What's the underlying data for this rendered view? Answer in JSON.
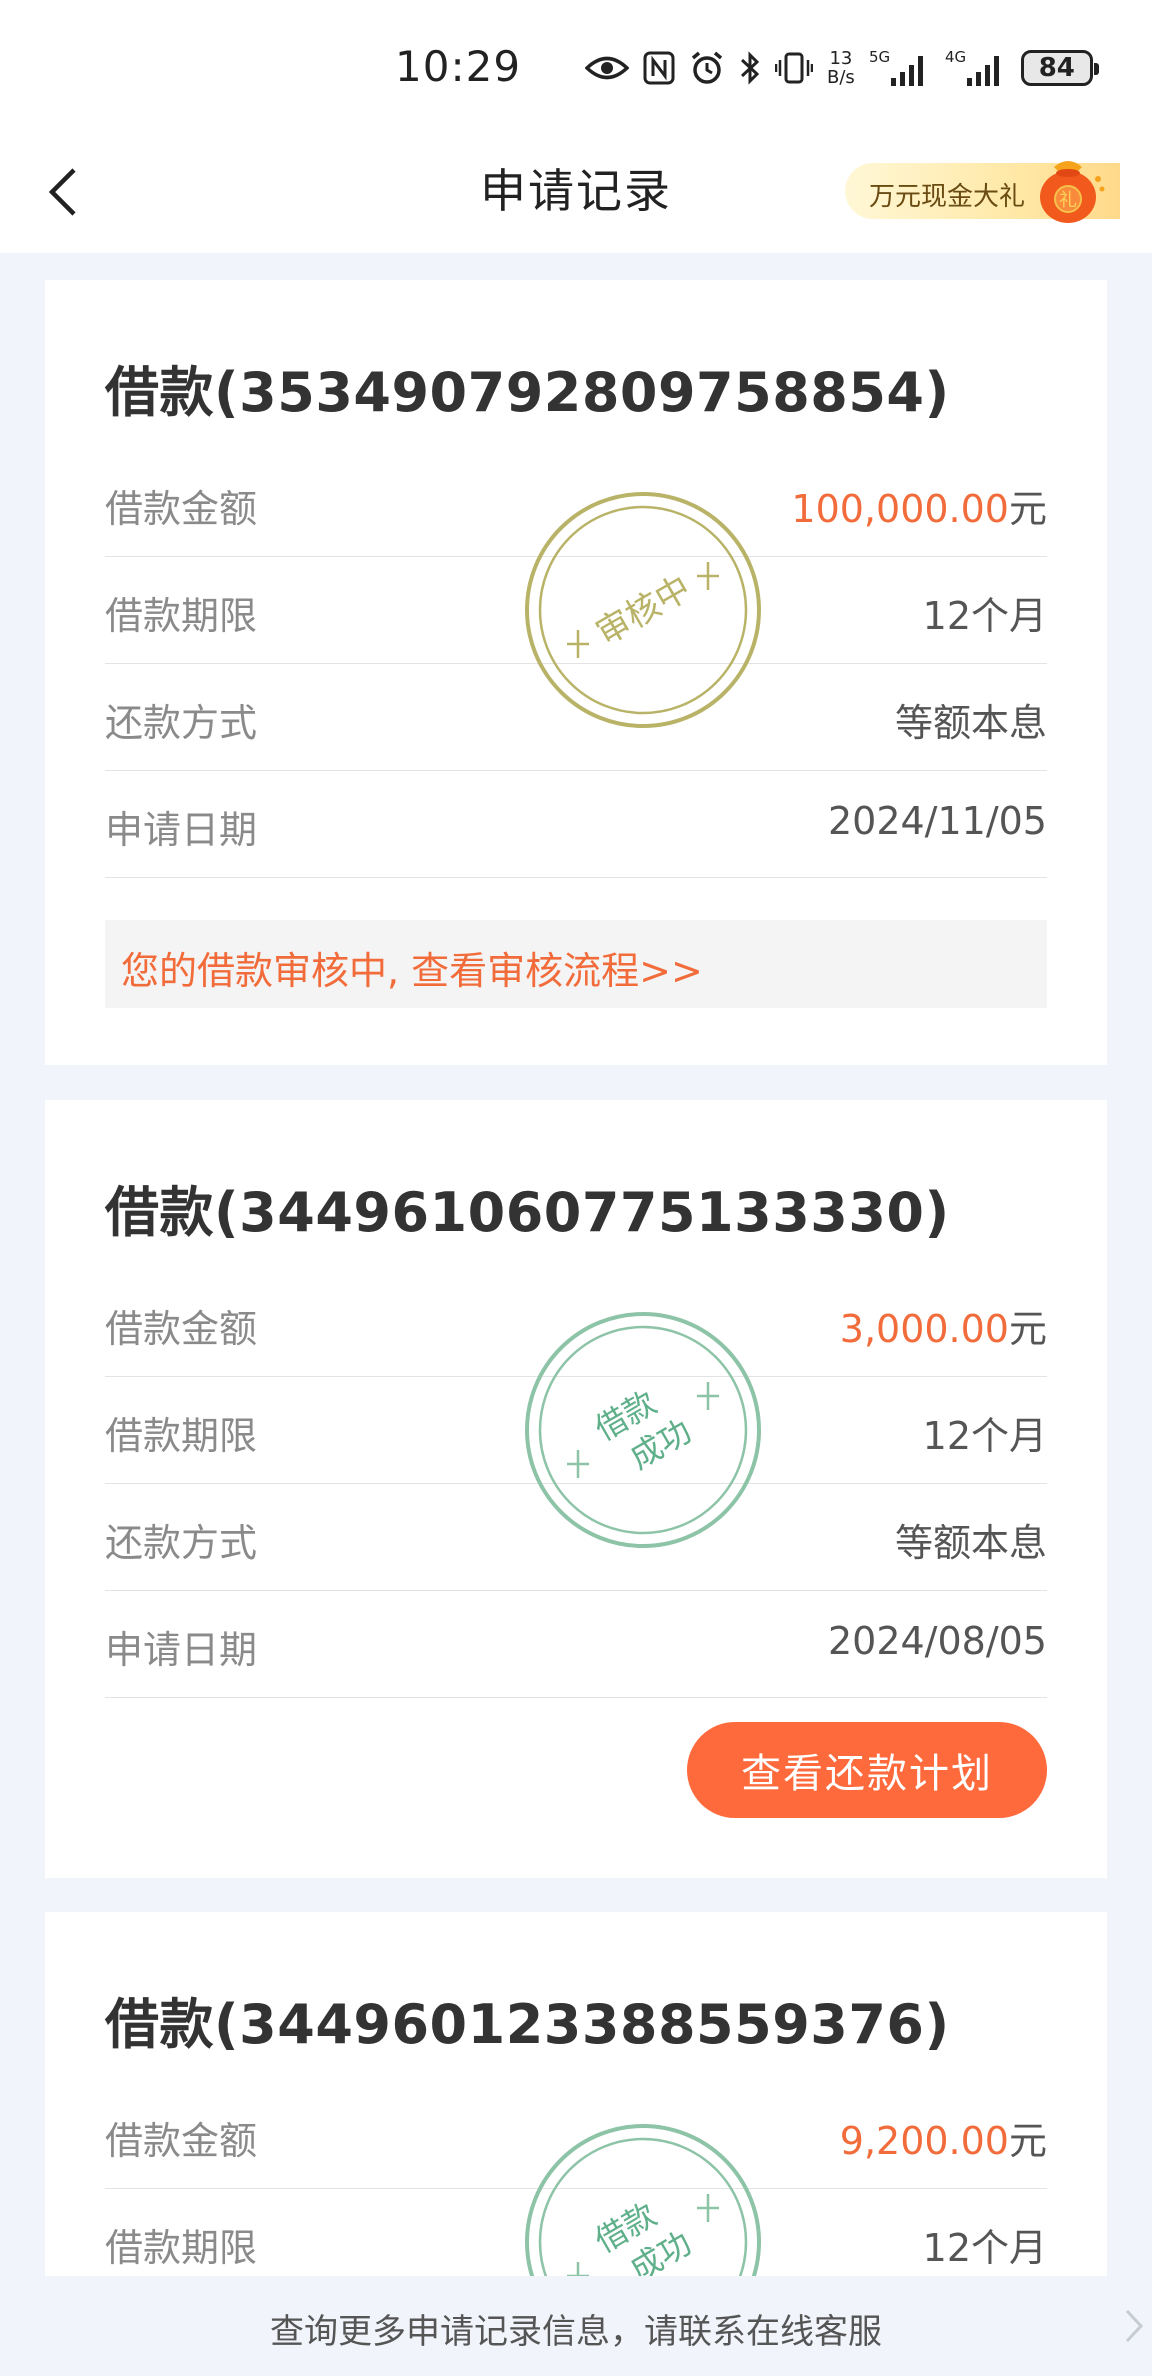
{
  "status_bar": {
    "time": "10:29",
    "net_speed_value": "13",
    "net_speed_unit": "B/s",
    "sim1": "5G",
    "sim2": "4G",
    "battery": "84"
  },
  "header": {
    "title": "申请记录",
    "promo": "万元现金大礼",
    "promo_bag_char": "礼"
  },
  "loans": [
    {
      "title": "借款(353490792809758854)",
      "amount_label": "借款金额",
      "amount_value": "100,000.00",
      "amount_unit": "元",
      "term_label": "借款期限",
      "term_value": "12个月",
      "method_label": "还款方式",
      "method_value": "等额本息",
      "date_label": "申请日期",
      "date_value": "2024/11/05",
      "stamp": "审核中",
      "notice": "您的借款审核中, 查看审核流程>>"
    },
    {
      "title": "借款(344961060775133330)",
      "amount_label": "借款金额",
      "amount_value": "3,000.00",
      "amount_unit": "元",
      "term_label": "借款期限",
      "term_value": "12个月",
      "method_label": "还款方式",
      "method_value": "等额本息",
      "date_label": "申请日期",
      "date_value": "2024/08/05",
      "stamp_line1": "借款",
      "stamp_line2": "成功",
      "action": "查看还款计划"
    },
    {
      "title": "借款(344960123388559376)",
      "amount_label": "借款金额",
      "amount_value": "9,200.00",
      "amount_unit": "元",
      "term_label": "借款期限",
      "term_value": "12个月",
      "stamp_line1": "借款",
      "stamp_line2": "成功"
    }
  ],
  "footer": {
    "text": "查询更多申请记录信息，请联系在线客服"
  },
  "colors": {
    "accent": "#f26b3a",
    "button": "#ff6a3c",
    "stamp_review": "#b9b368",
    "stamp_success": "#8dc3a6",
    "background": "#f1f4fa"
  }
}
